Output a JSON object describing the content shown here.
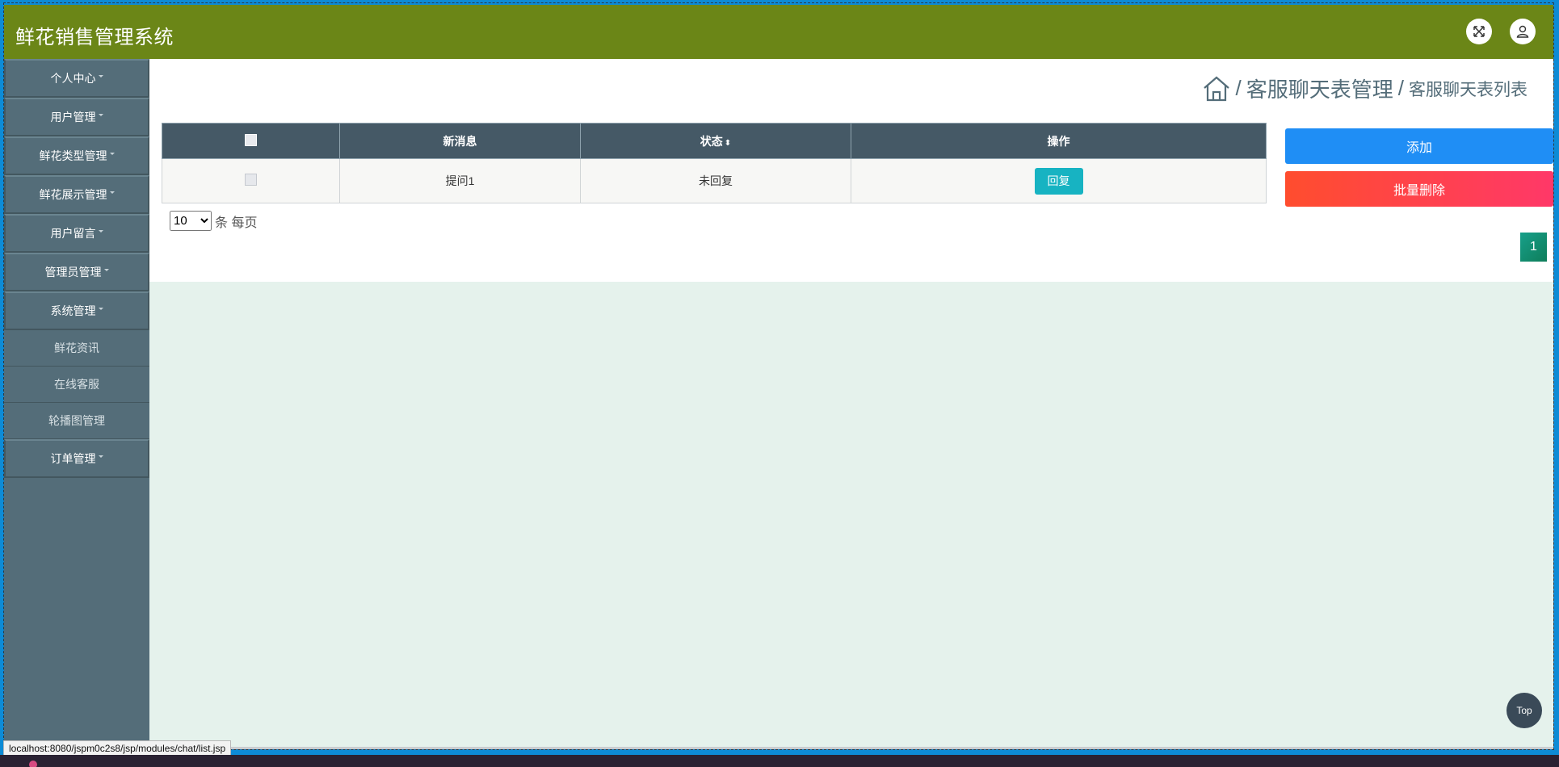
{
  "header": {
    "title": "鲜花销售管理系统",
    "expand_icon": "expand-arrows-icon",
    "user_icon": "user-icon"
  },
  "sidebar": {
    "items": [
      {
        "label": "个人中心",
        "dropdown": true
      },
      {
        "label": "用户管理",
        "dropdown": true
      },
      {
        "label": "鲜花类型管理",
        "dropdown": true
      },
      {
        "label": "鲜花展示管理",
        "dropdown": true
      },
      {
        "label": "用户留言",
        "dropdown": true
      },
      {
        "label": "管理员管理",
        "dropdown": true
      },
      {
        "label": "系统管理",
        "dropdown": true
      },
      {
        "label": "鲜花资讯",
        "dropdown": false
      },
      {
        "label": "在线客服",
        "dropdown": false
      },
      {
        "label": "轮播图管理",
        "dropdown": false
      },
      {
        "label": "订单管理",
        "dropdown": true
      }
    ]
  },
  "breadcrumb": {
    "home_icon": "home-icon",
    "separator": "/",
    "level1": "客服聊天表管理",
    "level2": "客服聊天表列表"
  },
  "table": {
    "columns": [
      "新消息",
      "状态",
      "操作"
    ],
    "sort_indicator": "⬍",
    "rows": [
      {
        "message": "提问1",
        "status": "未回复",
        "action": "回复"
      }
    ]
  },
  "pagination": {
    "page_size": "10",
    "page_size_options": [
      "10"
    ],
    "page_size_suffix": "条 每页",
    "current_page": "1"
  },
  "actions": {
    "add": "添加",
    "batch_delete": "批量删除"
  },
  "back_to_top": "Top",
  "status_bar_url": "localhost:8080/jspm0c2s8/jsp/modules/chat/list.jsp",
  "colors": {
    "header_bg": "#6b8617",
    "sidebar_bg": "#546d79",
    "table_header_bg": "#455966",
    "add_button": "#1f8ef5",
    "delete_button": "#ff4d2e",
    "reply_button": "#17b3c2",
    "page_active": "#17a08a"
  }
}
